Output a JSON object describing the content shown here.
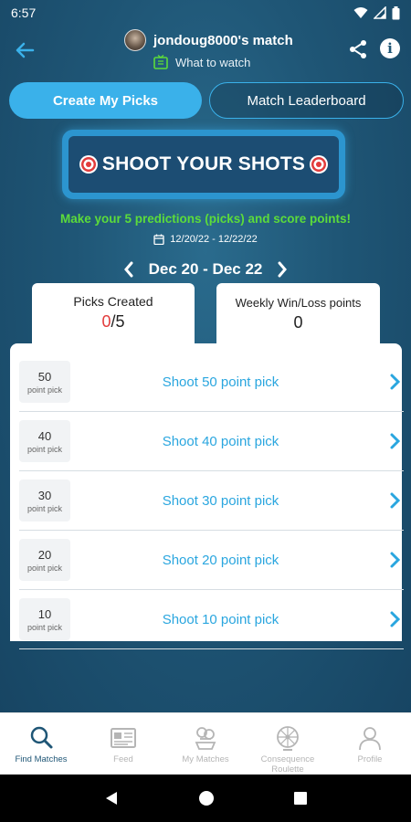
{
  "status_bar": {
    "time": "6:57"
  },
  "header": {
    "title": "jondoug8000's match",
    "subtitle": "What to watch"
  },
  "tabs": [
    {
      "label": "Create My Picks",
      "active": true
    },
    {
      "label": "Match Leaderboard",
      "active": false
    }
  ],
  "banner": {
    "text": "SHOOT YOUR SHOTS"
  },
  "tagline": "Make your 5 predictions (picks) and score points!",
  "date_range": "12/20/22 - 12/22/22",
  "week": {
    "label": "Dec 20 - Dec 22"
  },
  "stats": {
    "picks_created_label": "Picks Created",
    "picks_created_count": "0",
    "picks_created_total": "/5",
    "weekly_label": "Weekly Win/Loss points",
    "weekly_value": "0"
  },
  "picks": [
    {
      "points": "50",
      "points_label": "point pick",
      "action": "Shoot 50 point pick"
    },
    {
      "points": "40",
      "points_label": "point pick",
      "action": "Shoot 40 point pick"
    },
    {
      "points": "30",
      "points_label": "point pick",
      "action": "Shoot 30 point pick"
    },
    {
      "points": "20",
      "points_label": "point pick",
      "action": "Shoot 20 point pick"
    },
    {
      "points": "10",
      "points_label": "point pick",
      "action": "Shoot 10 point pick"
    }
  ],
  "bottom_nav": [
    {
      "label": "Find Matches",
      "icon": "search-icon",
      "active": true
    },
    {
      "label": "Feed",
      "icon": "newspaper-icon",
      "active": false
    },
    {
      "label": "My Matches",
      "icon": "trophy-icon",
      "active": false
    },
    {
      "label": "Consequence Roulette",
      "icon": "wheel-icon",
      "active": false
    },
    {
      "label": "Profile",
      "icon": "person-icon",
      "active": false
    }
  ],
  "colors": {
    "accent": "#3ab1ea",
    "background": "#1f5676",
    "tagline": "#5cdc3a",
    "count_red": "#e23b3b"
  }
}
